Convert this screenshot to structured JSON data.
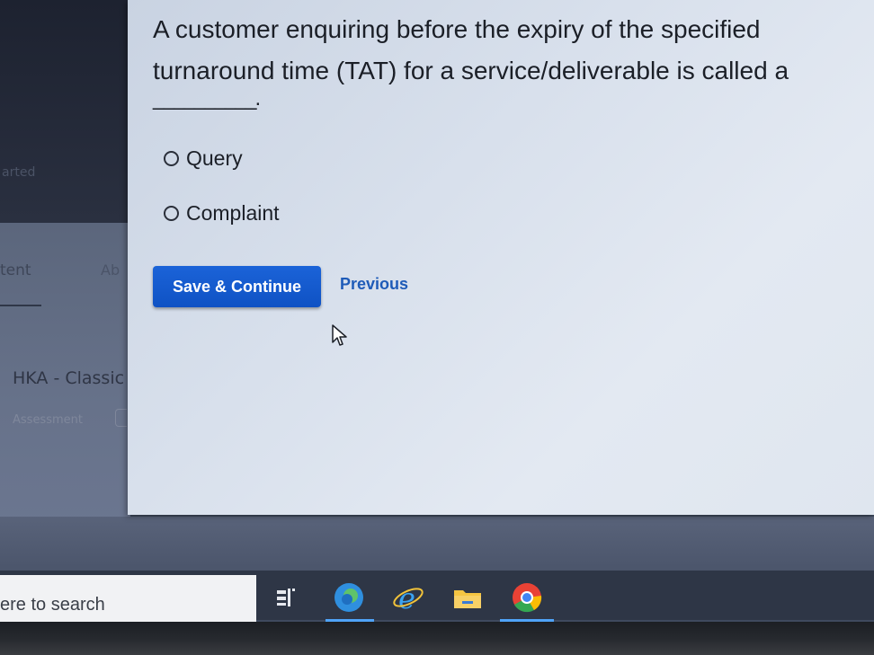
{
  "background": {
    "ghost_started": "arted",
    "ghost_content": "tent",
    "ghost_ab": "Ab",
    "ghost_course_title": "HKA - Classic",
    "ghost_course_sub": "Assessment"
  },
  "modal": {
    "question": "A customer enquiring before the expiry of the specified turnaround time (TAT) for a service/deliverable is called a",
    "blank": "__________.",
    "options": [
      {
        "label": "Query"
      },
      {
        "label": "Complaint"
      }
    ],
    "save_label": "Save & Continue",
    "previous_label": "Previous"
  },
  "taskbar": {
    "search_text": "ere to search"
  },
  "colors": {
    "primary_button": "#1259cf",
    "link": "#1e5bb8",
    "modal_bg": "#d8e0ec"
  }
}
